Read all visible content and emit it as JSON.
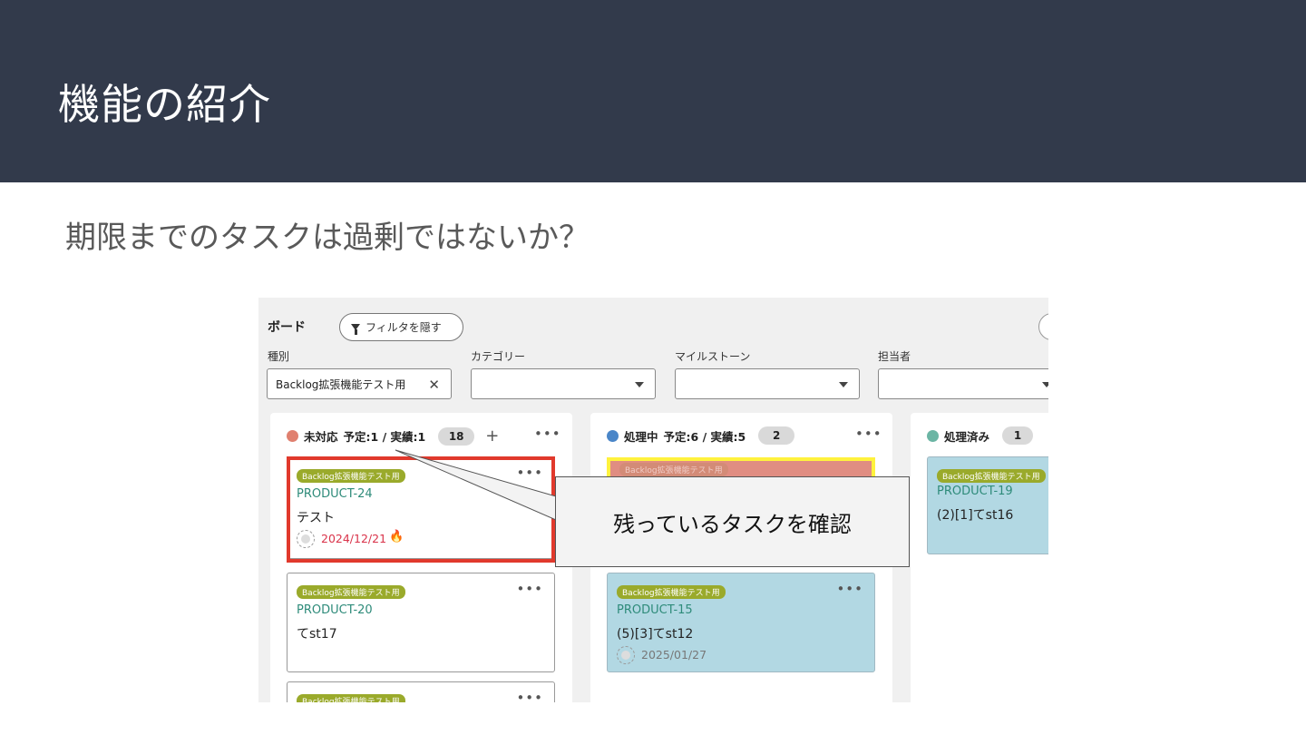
{
  "slide": {
    "title": "機能の紹介",
    "subtitle": "期限までのタスクは過剰ではないか？"
  },
  "board": {
    "title": "ボード",
    "filter_toggle_label": "フィルタを隠す",
    "filters": [
      {
        "label": "種別",
        "value": "Backlog拡張機能テスト用"
      },
      {
        "label": "カテゴリー",
        "value": ""
      },
      {
        "label": "マイルストーン",
        "value": ""
      },
      {
        "label": "担当者",
        "value": ""
      }
    ],
    "columns": [
      {
        "status": "未対応",
        "plan_actual": "予定:1 / 実績:1",
        "count": "18",
        "color": "#e0806f",
        "cards": [
          {
            "category": "Backlog拡張機能テスト用",
            "id": "PRODUCT-24",
            "summary": "テスト",
            "due": "2024/12/21"
          },
          {
            "category": "Backlog拡張機能テスト用",
            "id": "PRODUCT-20",
            "summary": "てst17"
          },
          {
            "category": "Backlog拡張機能テスト用"
          }
        ]
      },
      {
        "status": "処理中",
        "plan_actual": "予定:6 / 実績:5",
        "count": "2",
        "color": "#4a86c8",
        "cards": [
          {
            "category": "Backlog拡張機能テスト用"
          },
          {
            "category": "Backlog拡張機能テスト用",
            "id": "PRODUCT-15",
            "summary": "(5)[3]てst12",
            "due": "2025/01/27"
          }
        ]
      },
      {
        "status": "処理済み",
        "count": "1",
        "color": "#6bb5a4",
        "cards": [
          {
            "category": "Backlog拡張機能テスト用",
            "id": "PRODUCT-19",
            "summary": "(2)[1]てst16"
          }
        ]
      }
    ]
  },
  "callout": {
    "text": "残っているタスクを確認"
  },
  "icons": {
    "filter": "funnel-icon",
    "more": "ellipsis-icon",
    "add": "plus-icon",
    "overdue": "fire-icon",
    "avatar": "avatar-icon"
  }
}
